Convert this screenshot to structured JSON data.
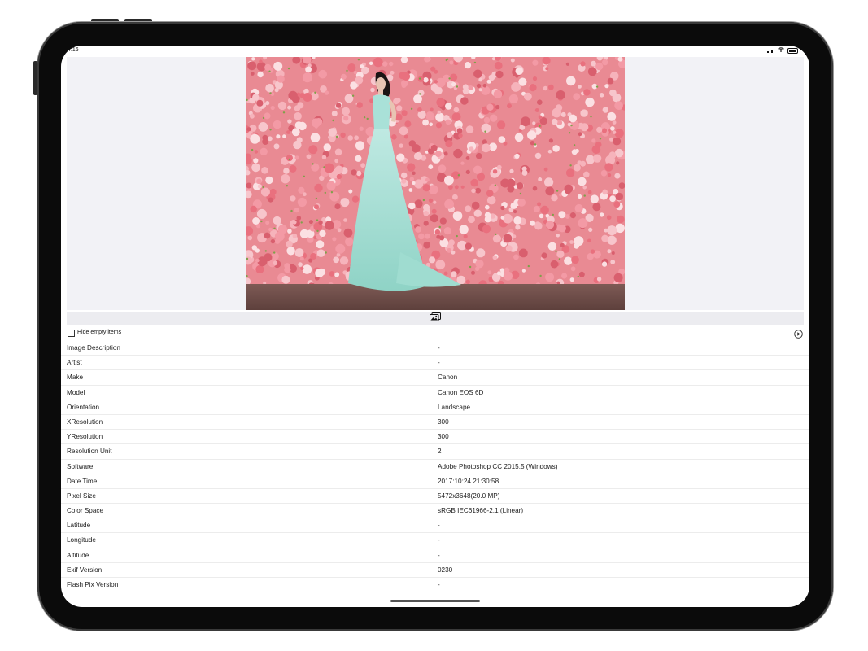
{
  "status_bar": {
    "time": "4:16"
  },
  "options": {
    "hide_empty_label": "Hide empty items"
  },
  "rows": [
    {
      "key": "Image Description",
      "value": "-"
    },
    {
      "key": "Artist",
      "value": "-"
    },
    {
      "key": "Make",
      "value": "Canon"
    },
    {
      "key": "Model",
      "value": "Canon EOS 6D"
    },
    {
      "key": "Orientation",
      "value": "Landscape"
    },
    {
      "key": "XResolution",
      "value": "300"
    },
    {
      "key": "YResolution",
      "value": "300"
    },
    {
      "key": "Resolution Unit",
      "value": "2"
    },
    {
      "key": "Software",
      "value": "Adobe Photoshop CC 2015.5 (Windows)"
    },
    {
      "key": "Date Time",
      "value": "2017:10:24 21:30:58"
    },
    {
      "key": "Pixel Size",
      "value": "5472x3648(20.0 MP)"
    },
    {
      "key": "Color Space",
      "value": "sRGB IEC61966-2.1 (Linear)"
    },
    {
      "key": "Latitude",
      "value": "-"
    },
    {
      "key": "Longitude",
      "value": "-"
    },
    {
      "key": "Altitude",
      "value": "-"
    },
    {
      "key": "Exif Version",
      "value": "0230"
    },
    {
      "key": "Flash Pix Version",
      "value": "-"
    }
  ],
  "icons": {
    "photo_library": "photo-library-icon",
    "play": "play-circle-icon",
    "signal": "cellular-signal-icon",
    "wifi": "wifi-icon",
    "battery": "battery-icon"
  },
  "colors": {
    "accent": "#000000",
    "preview_bg": "#f2f2f6",
    "toolbar_bg": "#ececf0"
  }
}
